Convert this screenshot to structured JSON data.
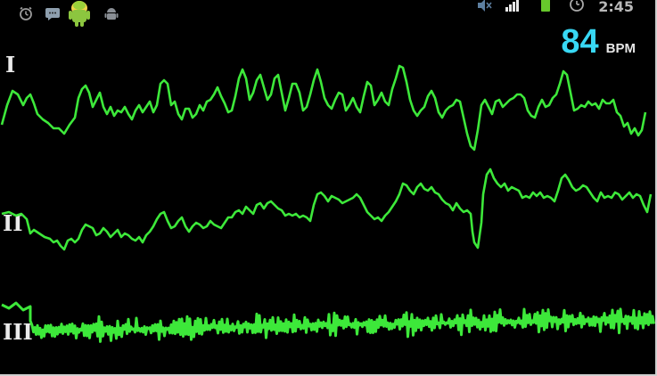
{
  "statusbar": {
    "left_icons": [
      "alarm-icon",
      "message-icon",
      "android-mascot-icon",
      "debug-android-icon"
    ],
    "right_icons": [
      "mute-icon",
      "signal-icon",
      "battery-icon",
      "clock-icon"
    ],
    "time": "2:45"
  },
  "monitor": {
    "heart_rate": "84",
    "heart_rate_unit": "BPM",
    "leads": [
      {
        "label": "I"
      },
      {
        "label": "II"
      },
      {
        "label": "III"
      }
    ],
    "trace_color": "#3de83a",
    "bpm_color": "#38d8f4"
  }
}
